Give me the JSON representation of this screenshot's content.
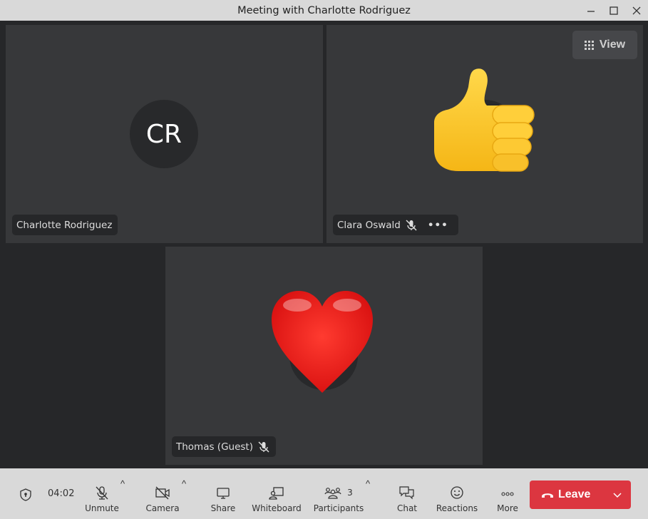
{
  "window": {
    "title": "Meeting with Charlotte Rodriguez",
    "controls": {
      "minimize": "–",
      "maximize": "☐",
      "close": "X"
    }
  },
  "view_button": {
    "label": "View",
    "icon": "grid-icon"
  },
  "tiles": [
    {
      "name": "Charlotte Rodriguez",
      "initials": "CR",
      "muted": false,
      "reaction": null
    },
    {
      "name": "Clara Oswald",
      "initials": "",
      "muted": true,
      "reaction": "👍",
      "more": "•••"
    },
    {
      "name": "Thomas (Guest)",
      "initials": "",
      "muted": true,
      "reaction": "❤️"
    }
  ],
  "toolbar": {
    "timer": "04:02",
    "unmute": "Unmute",
    "camera": "Camera",
    "share": "Share",
    "whiteboard": "Whiteboard",
    "participants": "Participants",
    "participants_count": "3",
    "chat": "Chat",
    "reactions": "Reactions",
    "more": "More",
    "leave": "Leave",
    "caret": "^"
  },
  "colors": {
    "leave": "#dc3640",
    "tile_bg": "#37383a",
    "stage_bg": "#262729",
    "toolbar_bg": "#d9d9d9"
  }
}
